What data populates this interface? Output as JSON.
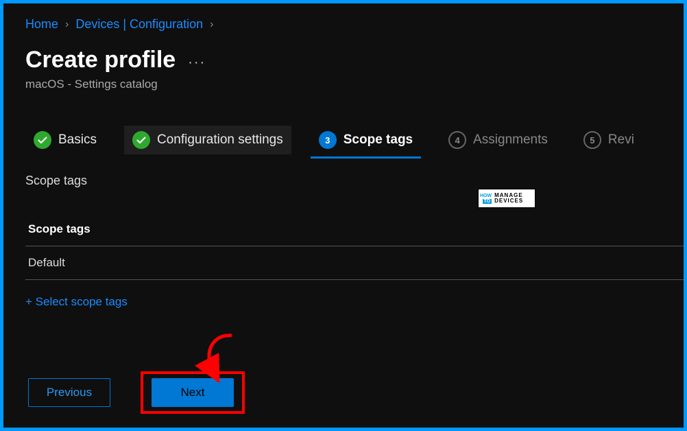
{
  "breadcrumb": {
    "home": "Home",
    "devices": "Devices | Configuration"
  },
  "header": {
    "title": "Create profile",
    "subtitle": "macOS - Settings catalog"
  },
  "steps": {
    "basics": "Basics",
    "config": "Configuration settings",
    "scopeNum": "3",
    "scope": "Scope tags",
    "assignNum": "4",
    "assign": "Assignments",
    "reviewNum": "5",
    "review": "Revi"
  },
  "section": {
    "heading": "Scope tags",
    "tableHeader": "Scope tags",
    "row1": "Default",
    "selectLink": "+ Select scope tags"
  },
  "buttons": {
    "previous": "Previous",
    "next": "Next"
  },
  "watermark": {
    "how": "HOW",
    "to": "TO",
    "manage": "MANAGE",
    "devices": "DEVICES"
  }
}
